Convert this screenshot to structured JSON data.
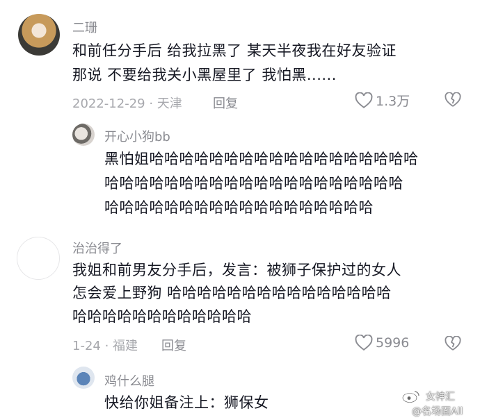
{
  "comments": [
    {
      "user": "二珊",
      "text_lines": [
        "和前任分手后 给我拉黑了 某天半夜我在好友验证",
        "那说 不要给我关小黑屋里了 我怕黑......"
      ],
      "date_location": "2022-12-29 · 天津",
      "reply_label": "回复",
      "likes": "1.3万"
    },
    {
      "user": "开心小狗bb",
      "text_lines": [
        "黑怕姐哈哈哈哈哈哈哈哈哈哈哈哈哈哈哈哈哈哈",
        "哈哈哈哈哈哈哈哈哈哈哈哈哈哈哈哈哈哈哈哈",
        "哈哈哈哈哈哈哈哈哈哈哈哈哈哈哈哈哈哈"
      ]
    },
    {
      "user": "治治得了",
      "text_lines": [
        "我姐和前男友分手后，发言：被狮子保护过的女人",
        "怎会爱上野狗 哈哈哈哈哈哈哈哈哈哈哈哈哈哈哈",
        "哈哈哈哈哈哈哈哈哈哈哈哈"
      ],
      "date_location": "1-24 · 福建",
      "reply_label": "回复",
      "likes": "5996"
    },
    {
      "user": "鸡什么腿",
      "text_lines": [
        "快给你姐备注上：狮保女"
      ]
    }
  ],
  "watermark": {
    "line1": "女神汇",
    "line2": "@名场面All"
  },
  "colors": {
    "primary_text": "#161823",
    "secondary_text": "#8a8b91",
    "meta_text": "#a7a8ad"
  },
  "icons": [
    "heart-outline-icon",
    "broken-heart-icon",
    "weibo-logo-icon"
  ]
}
